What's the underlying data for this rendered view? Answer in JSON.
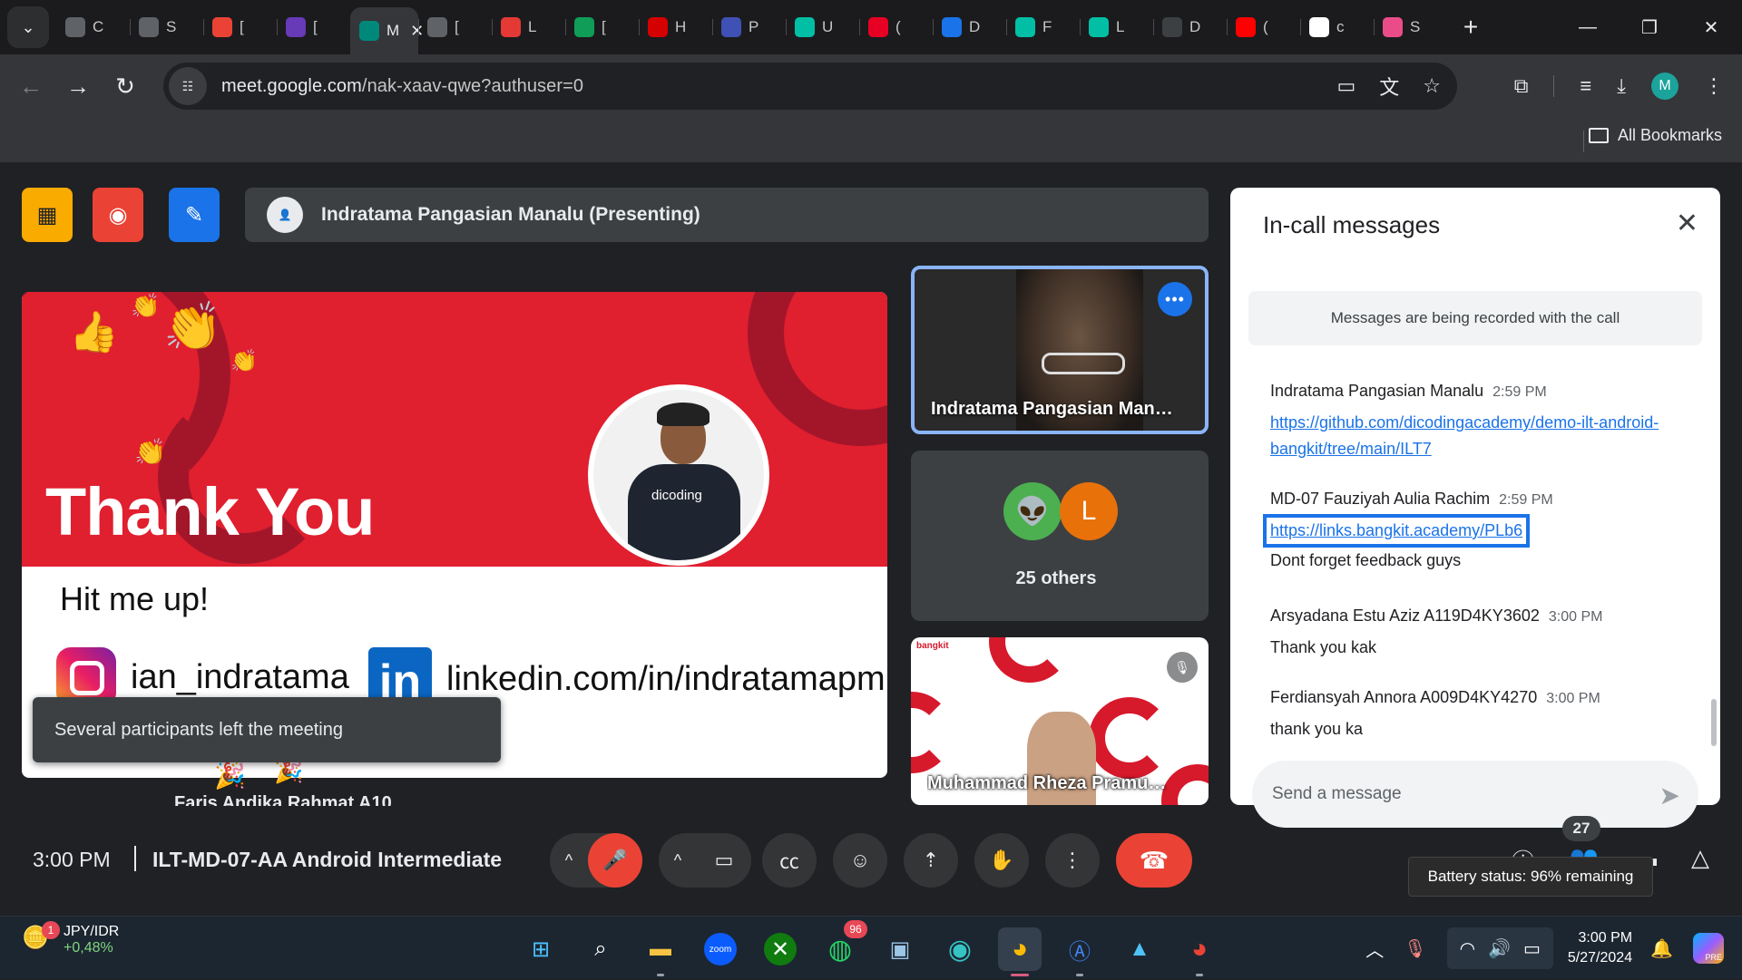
{
  "tabs": [
    {
      "label": "C",
      "icon": "contacts-icon",
      "color": "#5f6368"
    },
    {
      "label": "S",
      "icon": "settings-ring-icon",
      "color": "#5f6368"
    },
    {
      "label": "[",
      "icon": "gmail-icon",
      "color": "#ea4335"
    },
    {
      "label": "[",
      "icon": "forms-icon",
      "color": "#673ab7"
    },
    {
      "label": "M",
      "icon": "meet-icon",
      "color": "#00897b",
      "active": true
    },
    {
      "label": "[",
      "icon": "g-letter-icon",
      "color": "#5f6368"
    },
    {
      "label": "L",
      "icon": "trello-icon",
      "color": "#e53935"
    },
    {
      "label": "[",
      "icon": "sheets-icon",
      "color": "#0f9d58"
    },
    {
      "label": "H",
      "icon": "red-diamond-icon",
      "color": "#d50000"
    },
    {
      "label": "P",
      "icon": "bar-icon",
      "color": "#3f51b5"
    },
    {
      "label": "U",
      "icon": "v-logo-icon",
      "color": "#00bfa5"
    },
    {
      "label": "(",
      "icon": "pinterest-icon",
      "color": "#e60023"
    },
    {
      "label": "D",
      "icon": "chart-icon",
      "color": "#1a73e8"
    },
    {
      "label": "F",
      "icon": "d-logo-icon",
      "color": "#00bfa5"
    },
    {
      "label": "L",
      "icon": "d-logo-icon",
      "color": "#00bfa5"
    },
    {
      "label": "D",
      "icon": "play-icon",
      "color": "#3c4043"
    },
    {
      "label": "(",
      "icon": "youtube-icon",
      "color": "#ff0000"
    },
    {
      "label": "c",
      "icon": "google-icon",
      "color": "#ffffff"
    },
    {
      "label": "S",
      "icon": "dribbble-icon",
      "color": "#ea4c89"
    }
  ],
  "browser": {
    "url_host": "meet.google.com",
    "url_path": "/nak-xaav-qwe?authuser=0",
    "profile_initial": "M",
    "bookmarks_label": "All Bookmarks"
  },
  "meet": {
    "presenter_bar": "Indratama Pangasian Manalu (Presenting)",
    "slide": {
      "title": "Thank You",
      "subtitle": "Hit me up!",
      "instagram": "ian_indratama",
      "linkedin": "linkedin.com/in/indratamapm",
      "photo_logo": "dicoding"
    },
    "toast": "Several participants left the meeting",
    "under_slide_name": "Faris Andika Rahmat A10",
    "tiles": {
      "presenter_name": "Indratama Pangasian Manalu",
      "others_label": "25 others",
      "others_initial": "L",
      "third_name": "Muhammad Rheza Pramudya",
      "third_brand": "bangkit"
    },
    "clock": "3:00 PM",
    "meeting_title": "ILT-MD-07-AA Android Intermediate",
    "people_count": "27",
    "battery_tooltip": "Battery status: 96% remaining"
  },
  "chat": {
    "title": "In-call messages",
    "notice": "Messages are being recorded with the call",
    "messages": [
      {
        "sender": "Indratama Pangasian Manalu",
        "time": "2:59 PM",
        "link": "https://github.com/dicodingacademy/demo-ilt-android-bangkit/tree/main/ILT7"
      },
      {
        "sender": "MD-07 Fauziyah Aulia Rachim",
        "time": "2:59 PM",
        "link": "https://links.bangkit.academy/PLb6",
        "text": "Dont forget feedback guys"
      },
      {
        "sender": "Arsyadana Estu Aziz A119D4KY3602",
        "time": "3:00 PM",
        "text": "Thank you kak"
      },
      {
        "sender": "Ferdiansyah Annora A009D4KY4270",
        "time": "3:00 PM",
        "text": "thank you ka"
      }
    ],
    "input_placeholder": "Send a message"
  },
  "taskbar": {
    "widget_badge": "1",
    "widget_name": "JPY/IDR",
    "widget_change": "+0,48%",
    "whatsapp_badge": "96",
    "time": "3:00 PM",
    "date": "5/27/2024",
    "copilot_label": "PRE"
  }
}
